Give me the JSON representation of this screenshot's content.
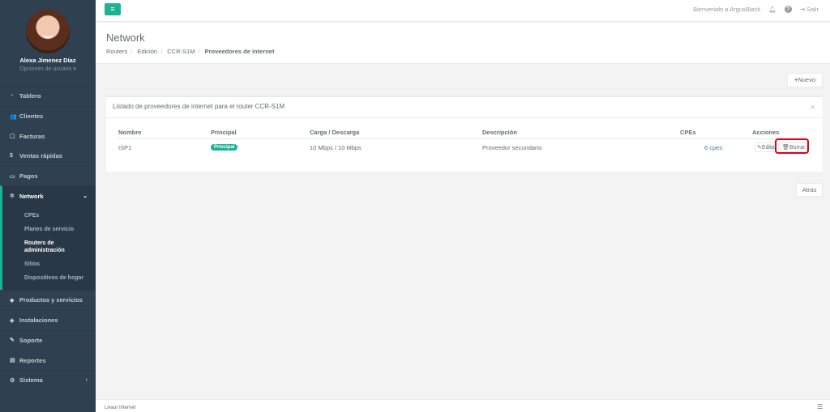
{
  "sidebar": {
    "user_name": "Alexa Jimenez Díaz",
    "user_options": "Opciones de usuario",
    "items": [
      {
        "label": "Tablero",
        "icon": "dashboard-icon"
      },
      {
        "label": "Clientes",
        "icon": "users-icon"
      },
      {
        "label": "Facturas",
        "icon": "file-icon"
      },
      {
        "label": "Ventas rápidas",
        "icon": "dollar-icon"
      },
      {
        "label": "Pagos",
        "icon": "money-icon"
      },
      {
        "label": "Network",
        "icon": "network-icon"
      },
      {
        "label": "Productos y servicios",
        "icon": "tag-icon"
      },
      {
        "label": "Instalaciones",
        "icon": "wrench-icon"
      },
      {
        "label": "Soporte",
        "icon": "support-icon"
      },
      {
        "label": "Reportes",
        "icon": "book-icon"
      },
      {
        "label": "Sistema",
        "icon": "cogs-icon"
      }
    ],
    "network_sub": [
      "CPEs",
      "Planes de servicio",
      "Routers de administración",
      "Sitios",
      "Dispositivos de hogar"
    ]
  },
  "topbar": {
    "welcome": "Bienvenido a ArgusBlack",
    "help": "?",
    "logout": "Salir"
  },
  "heading": {
    "title": "Network",
    "breadcrumb": [
      "Routers",
      "Edición",
      "CCR-S1M",
      "Proveedores de internet"
    ]
  },
  "actions": {
    "new_label": "Nuevo",
    "back_label": "Atras"
  },
  "panel": {
    "title": "Listado de proveedores de internet para el router CCR-S1M",
    "columns": [
      "Nombre",
      "Principal",
      "Carga / Descarga",
      "Descripción",
      "CPEs",
      "Acciones"
    ],
    "rows": [
      {
        "name": "ISP1",
        "principal": "Principal",
        "speed": "10 Mbps / 10 Mbps",
        "description": "Proveedor secundario",
        "cpes": "6 cpes",
        "edit": "Editar",
        "delete": "Borrar"
      }
    ]
  },
  "footer": {
    "text": "Livaur Internet"
  }
}
